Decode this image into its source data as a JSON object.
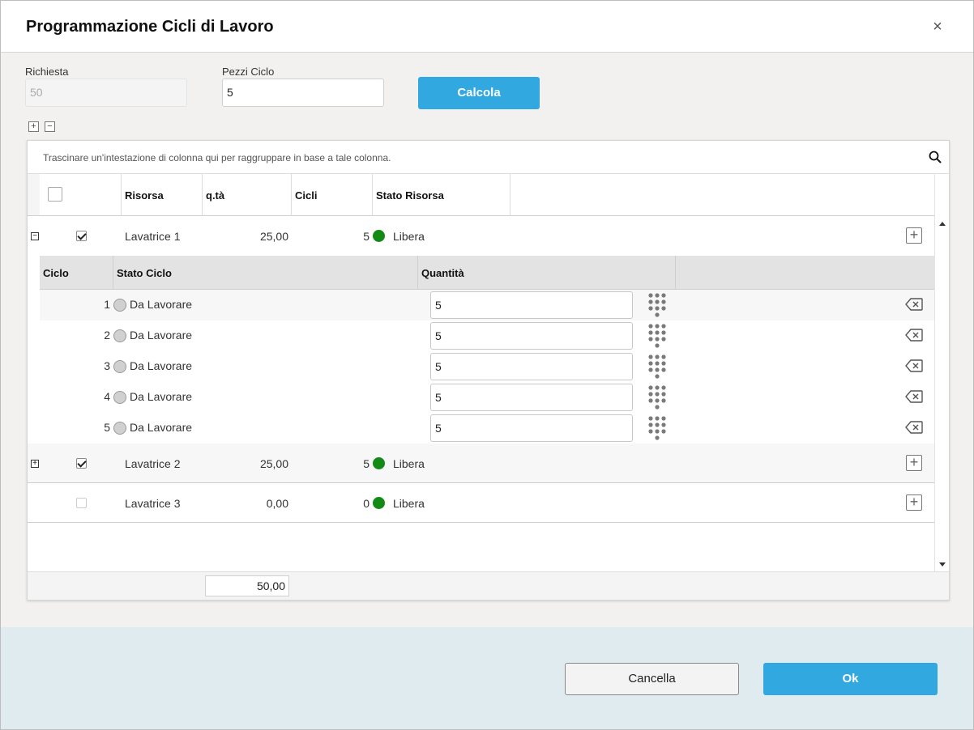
{
  "dialog": {
    "title": "Programmazione Cicli di Lavoro",
    "close_glyph": "×"
  },
  "form": {
    "richiesta_label": "Richiesta",
    "richiesta_value": "50",
    "pezzi_label": "Pezzi Ciclo",
    "pezzi_value": "5",
    "calcola_label": "Calcola"
  },
  "expand_controls": {
    "expand_glyph": "+",
    "collapse_glyph": "−"
  },
  "grid": {
    "group_panel_text": "Trascinare un'intestazione di colonna qui per raggruppare in base a tale colonna.",
    "columns": [
      "Risorsa",
      "q.tà",
      "Cicli",
      "Stato Risorsa"
    ],
    "rows": [
      {
        "risorsa": "Lavatrice 1",
        "qta": "25,00",
        "cicli": "5",
        "stato": "Libera",
        "checked": true,
        "expanded": true
      },
      {
        "risorsa": "Lavatrice 2",
        "qta": "25,00",
        "cicli": "5",
        "stato": "Libera",
        "checked": true,
        "expanded": false
      },
      {
        "risorsa": "Lavatrice 3",
        "qta": "0,00",
        "cicli": "0",
        "stato": "Libera",
        "checked": false,
        "expanded": null
      }
    ],
    "detail": {
      "columns": [
        "Ciclo",
        "Stato Ciclo",
        "Quantità"
      ],
      "rows": [
        {
          "ciclo": "1",
          "stato": "Da Lavorare",
          "quantita": "5"
        },
        {
          "ciclo": "2",
          "stato": "Da Lavorare",
          "quantita": "5"
        },
        {
          "ciclo": "3",
          "stato": "Da Lavorare",
          "quantita": "5"
        },
        {
          "ciclo": "4",
          "stato": "Da Lavorare",
          "quantita": "5"
        },
        {
          "ciclo": "5",
          "stato": "Da Lavorare",
          "quantita": "5"
        }
      ]
    },
    "footer_total": "50,00",
    "status_color_free": "#138a16"
  },
  "buttons": {
    "cancel_label": "Cancella",
    "ok_label": "Ok"
  },
  "colors": {
    "accent": "#31a9e0",
    "bottom_bar": "#e0ebf0"
  }
}
